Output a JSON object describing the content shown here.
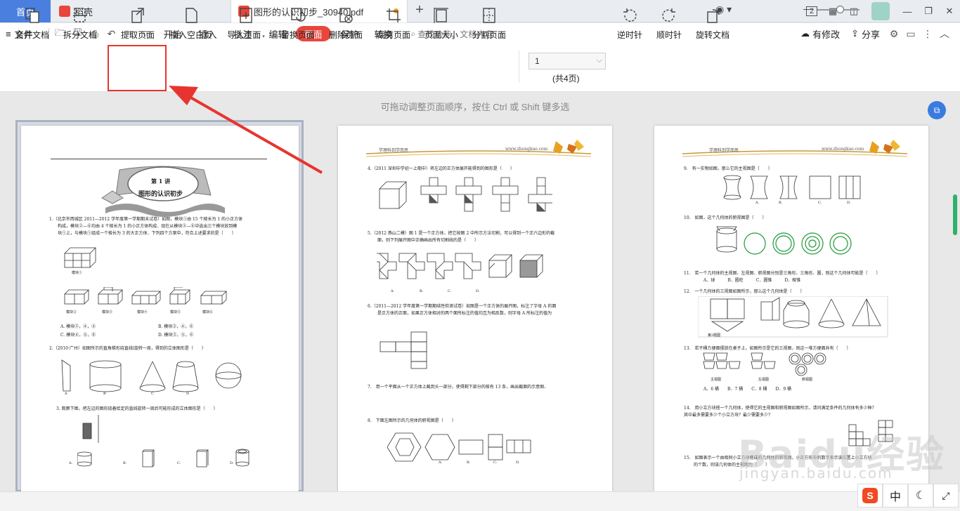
{
  "tabs": {
    "home": "首页",
    "daoke": "稻壳",
    "document": "图形的认识初步_30940.pdf",
    "new_tab": "+"
  },
  "window": {
    "badge": "2"
  },
  "menu": {
    "file": "文件",
    "items": [
      "开始",
      "插入",
      "批注",
      "编辑",
      "页面",
      "保护",
      "转换"
    ],
    "active": "页面",
    "search": "查找功能、文档内容",
    "has_changes": "有修改",
    "share": "分享"
  },
  "ribbon": {
    "merge": "合并文档",
    "split": "拆分文档",
    "extract": "提取页面",
    "insert_blank": "插入空白页",
    "import": "导入页面",
    "replace": "替换页面",
    "delete": "删除页面",
    "crop": "裁剪页面",
    "size": "页面大小",
    "divide": "分割页面",
    "page_number": "1",
    "page_total": "(共4页)",
    "ccw": "逆时针",
    "cw": "顺时针",
    "rotate": "旋转文档"
  },
  "workspace": {
    "hint": "可拖动调整页面顺序，按住 Ctrl 或 Shift 键多选"
  },
  "page1": {
    "lesson": "第 1 讲",
    "title": "图形的认识初步",
    "q1": "1.（北京市西城区 2011—2012 学年度第一学期期末试卷）如图，模块①由 15 个棱长为 1 的小正方体",
    "q1b": "构成，模块②—⑥均由 4 个棱长为 1 的小正方体构成．现在从模块②—⑥中选出三个模块放到模",
    "q1c": "块①上，与模块①组成一个棱长为 3 的大正方体．下列四个方案中，符合上述要求的是（　　）",
    "q1_label": "模块①",
    "q1_labels": [
      "模块②",
      "模块③",
      "模块④",
      "模块⑤",
      "模块⑥"
    ],
    "q1_opts": [
      "A. 模块②，④，⑤",
      "B. 模块③，④，⑥",
      "C. 模块④，⑤，⑥",
      "D. 模块③，⑤，⑥"
    ],
    "q2": "2.（2010·广州）如图所示的直角梯形绕直线l旋转一周，得到的立体图形是（　　）",
    "q2_opts": [
      "A",
      "B",
      "C",
      "D"
    ],
    "q3": "3. 观察下图，把左边的图形绕着给定的直线旋转一周后可能形成的立体图形是（　　）",
    "q3_opts": [
      "A.",
      "B.",
      "C.",
      "D."
    ]
  },
  "page2": {
    "header_left": "学理科到学而思",
    "header_right": "www.zhongkao.com",
    "q4": "4.（2011 深圳中学初一上期中）将左边的正方体展开能得到的图形是（　　）",
    "q5": "5.（2012 燕山二模）图 1 是一个正方体，把它按图 2 中所示方法切割，可以得到一个正六边形的截",
    "q5b": "面，则下列展开图中正确画出所有切割线的是（　　）",
    "q5_opts": [
      "A.",
      "B.",
      "C.",
      "D."
    ],
    "q6": "6.（2011—2012 学年度第一学期期结性检测试卷）如图是一个正方体的展开图，标注了字母 A 的面",
    "q6b": "是正方体的正面，如果正方体相对的两个面所标注的值均互为相反数，则字母 A 所标注的值为",
    "q7": "7.　用一个平面从一个正方体上截到头一部分，使得剩下部分的棱有 13 条，画出截面的示意图．",
    "q8": "8.　下面左图所示的几何体的俯视图是（　　）",
    "q8_opts": [
      "A.",
      "B.",
      "C.",
      "D."
    ]
  },
  "page3": {
    "header_left": "学理科到学而思",
    "header_right": "www.zhongkao.com",
    "q9": "9.　有一实物如图，那么它的主视图是（　　）",
    "q9_opts": [
      "A.",
      "B.",
      "C.",
      "D."
    ],
    "q10": "10.　如图，这个几何体的俯视图是（　　）",
    "q11": "11.　若一个几何体的主视图、左视图、俯视图分别是三角形、三角形、圆，则这个几何体可能是（　　）",
    "q11_opts": "A．球　　　B．圆柱　　　C．圆锥　　　D．棱锥",
    "q12": "12.　一个几何体的三视图如图所示，那么这个几何体是（　　）",
    "q12_label": "第3题图",
    "q13": "13.　若干桶方便面摆放在桌子上，如图所示是它的三视图，则这一堆方便面共有（　　）",
    "q13_views": [
      "主视图",
      "左视图",
      "俯视图"
    ],
    "q13_opts": "A．6 桶　　B．7 桶　　C．8 桶　　D．9 桶",
    "q14": "14.　用小立方块搭一个几何体，使得它的主视图和俯视图如图所示，请问满足条件的几何体有多少种?",
    "q14b": "其中最多需要多少个小立方块？最少需要多少?",
    "q15": "15.　如图表示一个由相同小立方块搭成的几何体的俯视图，小正方形中的数字表示该位置上小立方块",
    "q15b": "的个数，则该几何体的主视图为（　　）"
  },
  "statusbar": {
    "ime_lang": "中"
  },
  "watermark": {
    "brand": "Baidu经验",
    "url": "jingyan.baidu.com"
  },
  "colors": {
    "accent": "#e8463c",
    "home_tab": "#4a7fe0",
    "highlight": "#e8342e"
  }
}
